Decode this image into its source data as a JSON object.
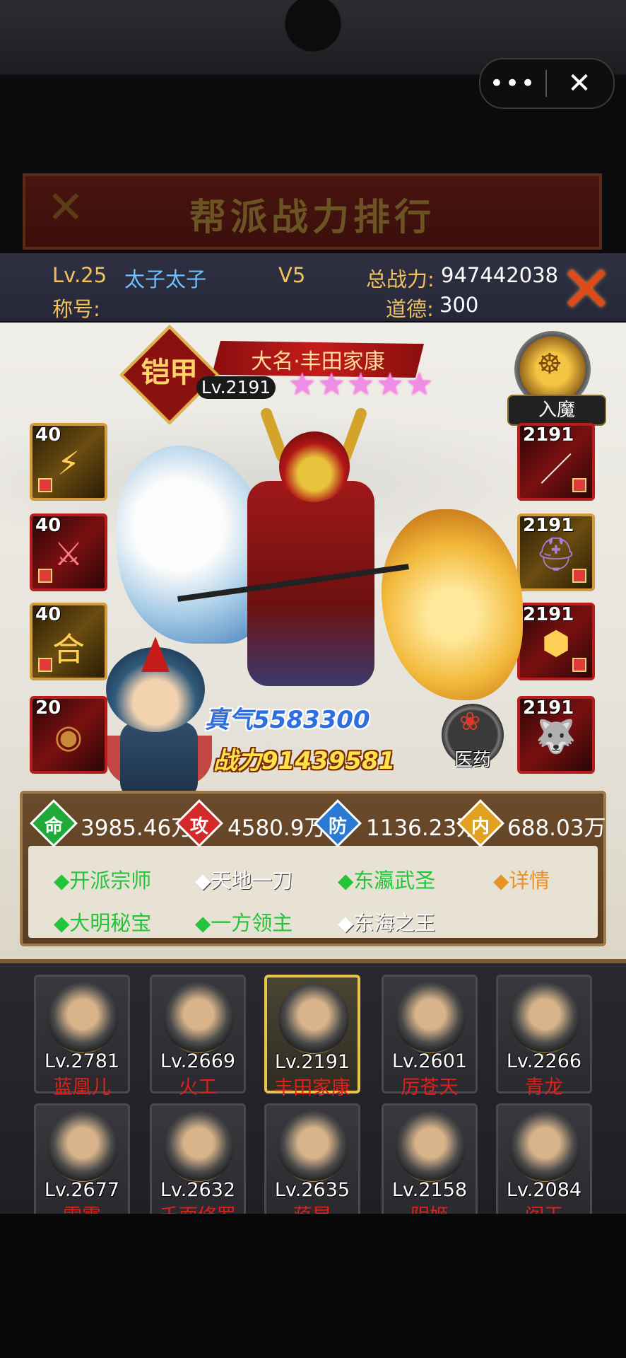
{
  "capsule": {
    "more_icon": "•••",
    "close_icon": "✕"
  },
  "backdrop_title": "帮派战力排行",
  "player": {
    "level": "Lv.25",
    "name": "太子太子",
    "vip": "V5",
    "total_power_label": "总战力:",
    "total_power": "947442038",
    "title_label": "称号:",
    "morality_label": "道德:",
    "morality": "300"
  },
  "hero": {
    "armor_badge": "铠甲",
    "name": "大名·丰田家康",
    "level": "Lv.2191",
    "stars": "★★★★★",
    "demon_label": "入魔",
    "qi": "真气5583300",
    "power": "战力91439581",
    "medicine_label": "医药"
  },
  "skills": [
    {
      "level": "40",
      "icon": "claw-icon"
    },
    {
      "level": "40",
      "icon": "blade-slash-icon"
    },
    {
      "level": "40",
      "icon": "he-combo-icon",
      "glyph": "合"
    },
    {
      "level": "20",
      "icon": "compass-icon"
    }
  ],
  "equipment": [
    {
      "level": "2191",
      "icon": "katana-icon"
    },
    {
      "level": "2191",
      "icon": "helmet-icon"
    },
    {
      "level": "2191",
      "icon": "armor-icon"
    },
    {
      "level": "2191",
      "icon": "wolf-icon"
    }
  ],
  "stats": [
    {
      "label": "命",
      "value": "3985.46万",
      "color": "#1faa3a"
    },
    {
      "label": "攻",
      "value": "4580.9万",
      "color": "#d42a2a"
    },
    {
      "label": "防",
      "value": "1136.23万",
      "color": "#2a7ad4"
    },
    {
      "label": "内",
      "value": "688.03万",
      "color": "#e0a020"
    }
  ],
  "titles_row1": [
    "◆开派宗师",
    "◆天地一刀",
    "◆东瀛武圣",
    "◆详情"
  ],
  "titles_row2": [
    "◆大明秘宝",
    "◆一方领主",
    "◆东海之王"
  ],
  "roster": [
    {
      "level": "Lv.2781",
      "name": "蓝凰儿"
    },
    {
      "level": "Lv.2669",
      "name": "火工"
    },
    {
      "level": "Lv.2191",
      "name": "丰田家康"
    },
    {
      "level": "Lv.2601",
      "name": "厉苍天"
    },
    {
      "level": "Lv.2266",
      "name": "青龙"
    },
    {
      "level": "Lv.2677",
      "name": "雷震"
    },
    {
      "level": "Lv.2632",
      "name": "千面修罗"
    },
    {
      "level": "Lv.2635",
      "name": "蒋昆"
    },
    {
      "level": "Lv.2158",
      "name": "阴姬"
    },
    {
      "level": "Lv.2084",
      "name": "阎王"
    }
  ]
}
